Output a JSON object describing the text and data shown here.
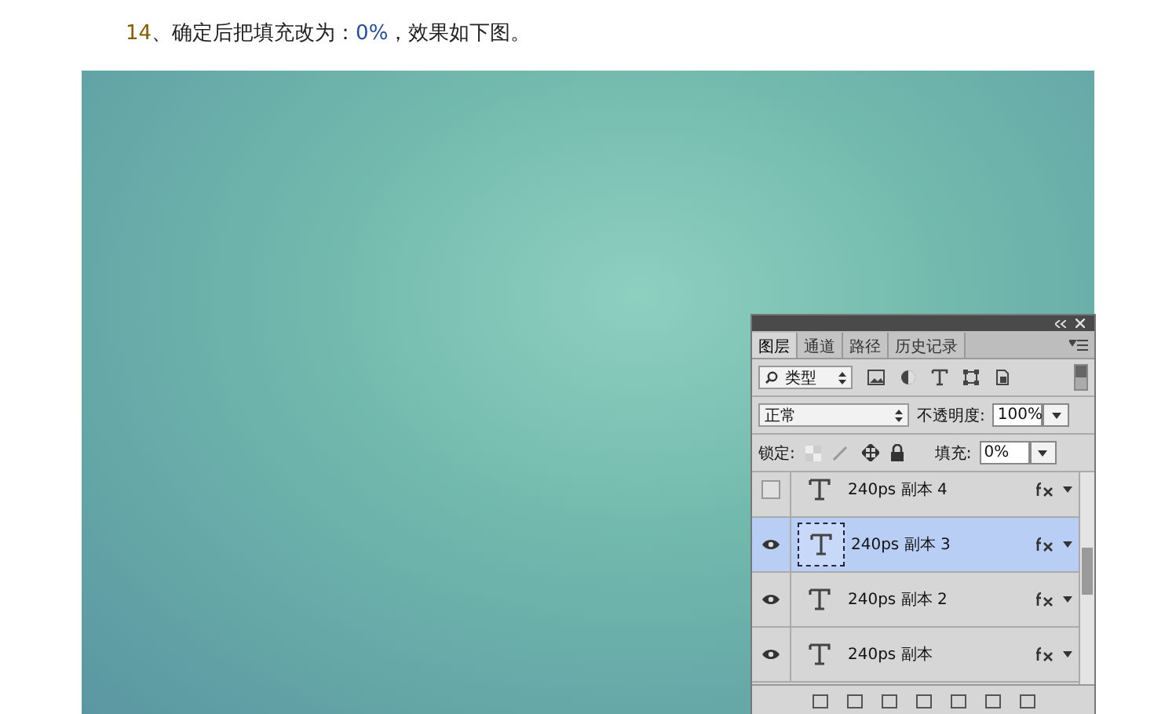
{
  "heading": {
    "parts": [
      {
        "text": "14",
        "color": "#8a5a00"
      },
      {
        "text": "、确定后把填充改为：",
        "color": "#222222"
      },
      {
        "text": "0%",
        "color": "#1f4f9f"
      },
      {
        "text": "，效果如下图。",
        "color": "#222222"
      }
    ]
  },
  "panel": {
    "tabs": [
      {
        "label": "图层",
        "selected": true
      },
      {
        "label": "通道",
        "selected": false
      },
      {
        "label": "路径",
        "selected": false
      },
      {
        "label": "历史记录",
        "selected": false
      }
    ],
    "filter": {
      "value": "类型"
    },
    "blend": {
      "value": "正常"
    },
    "opacity": {
      "label": "不透明度:",
      "value": "100%"
    },
    "lock": {
      "label": "锁定:"
    },
    "fill": {
      "label": "填充:",
      "value": "0%"
    },
    "layers": [
      {
        "name": "240ps 副本 4",
        "visible": false,
        "selected": false
      },
      {
        "name": "240ps 副本 3",
        "visible": true,
        "selected": true
      },
      {
        "name": "240ps 副本 2",
        "visible": true,
        "selected": false
      },
      {
        "name": "240ps 副本",
        "visible": true,
        "selected": false
      }
    ]
  }
}
